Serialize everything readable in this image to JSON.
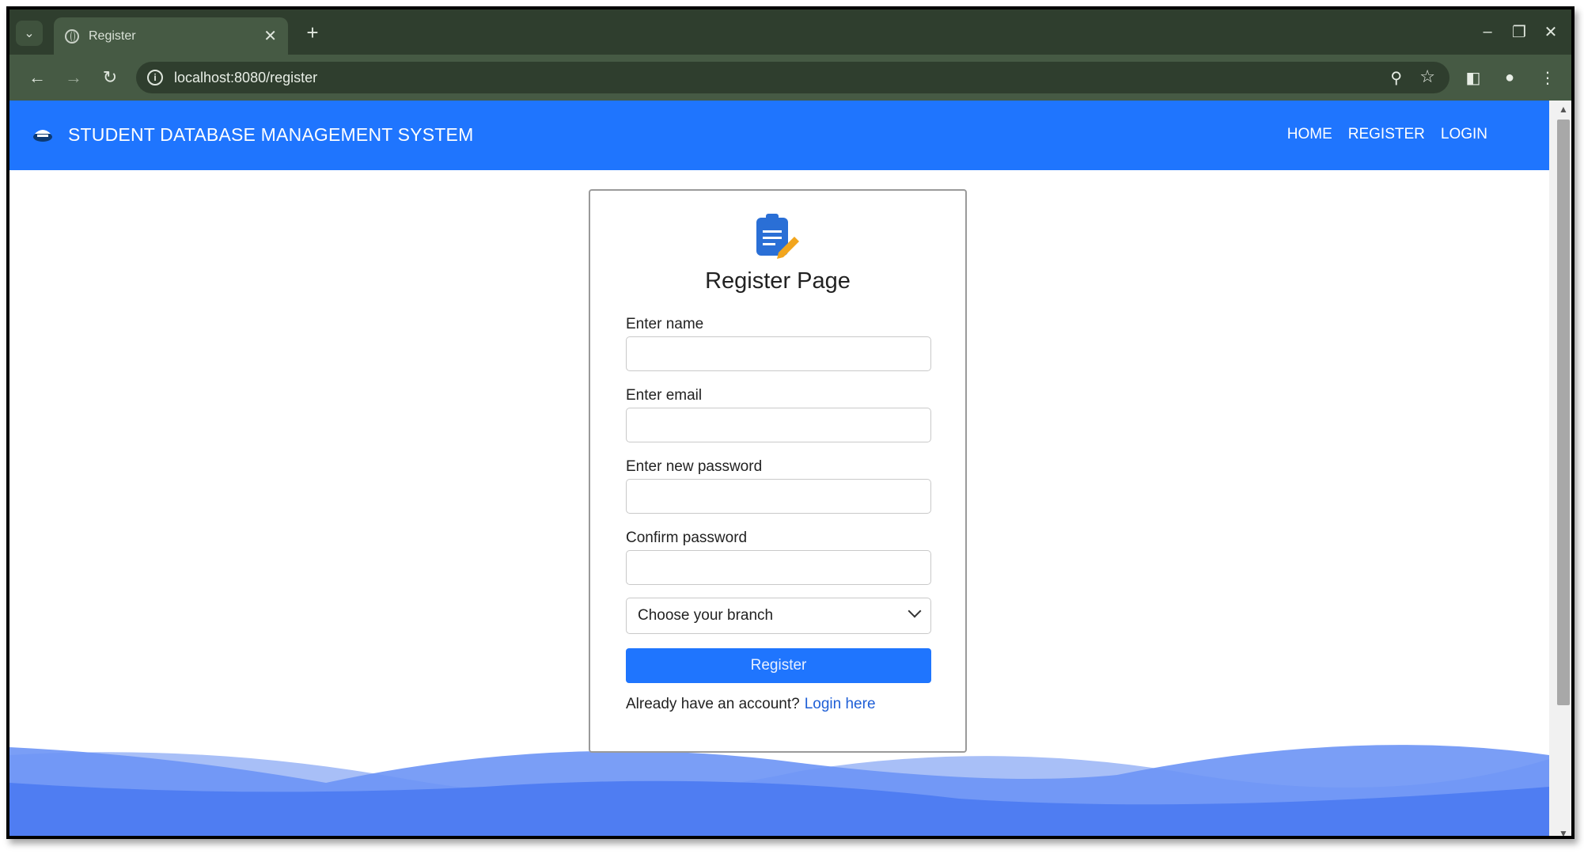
{
  "browser": {
    "tab_title": "Register",
    "url": "localhost:8080/register"
  },
  "navbar": {
    "brand": "STUDENT DATABASE MANAGEMENT SYSTEM",
    "links": [
      "HOME",
      "REGISTER",
      "LOGIN"
    ]
  },
  "form": {
    "title": "Register Page",
    "name_label": "Enter name",
    "email_label": "Enter email",
    "password_label": "Enter new password",
    "confirm_label": "Confirm password",
    "branch_select": "Choose your branch",
    "submit_label": "Register",
    "already_text": "Already have an account?",
    "login_link": "Login here"
  },
  "colors": {
    "accent": "#1f75fe",
    "chrome_dark": "#2f3e2e",
    "chrome_light": "#465a44",
    "wave_light": "#a8bff7",
    "wave_dark": "#4f7df2"
  }
}
